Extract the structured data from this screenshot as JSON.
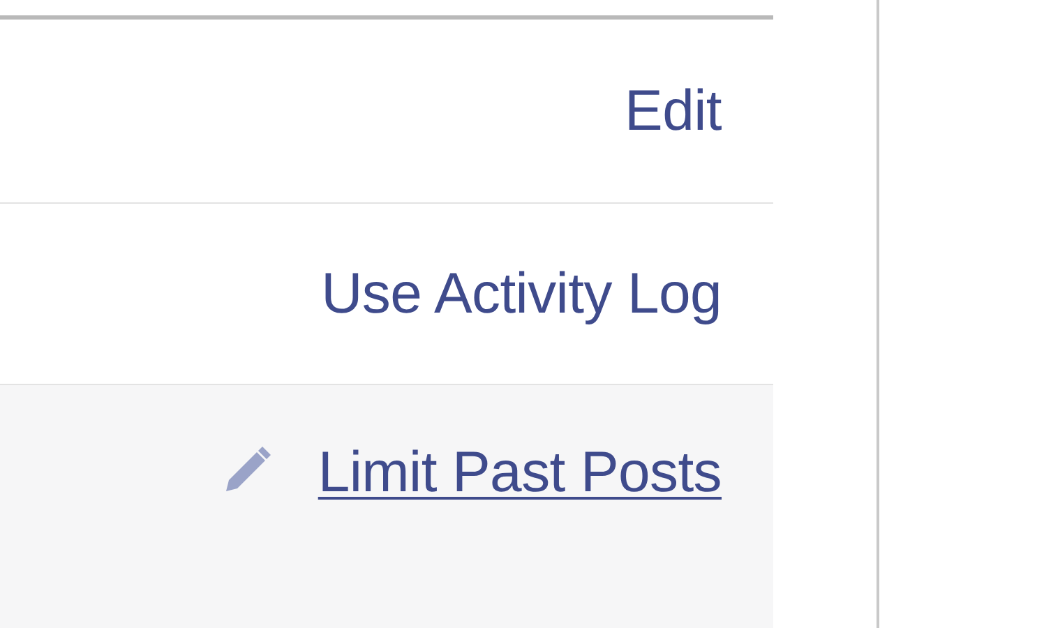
{
  "rows": [
    {
      "label": "Edit",
      "hovered": false,
      "kind": "plain"
    },
    {
      "label": "Use Activity Log",
      "hovered": false,
      "kind": "plain"
    },
    {
      "label": "Limit Past Posts",
      "hovered": true,
      "kind": "editable"
    }
  ]
}
